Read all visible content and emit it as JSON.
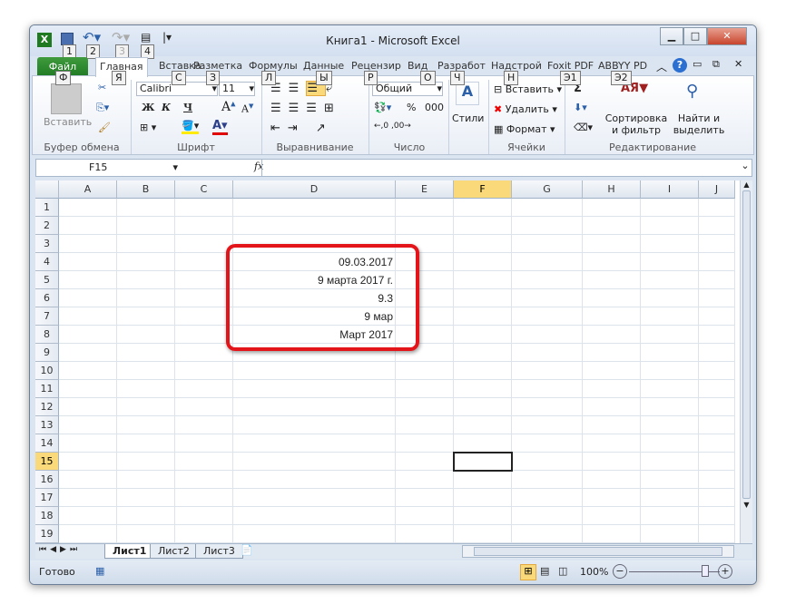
{
  "title": "Книга1  -  Microsoft Excel",
  "qat_keytips": [
    "1",
    "2",
    "3",
    "4"
  ],
  "file_tab": "Файл",
  "file_keytip": "Ф",
  "tabs": [
    {
      "label": "Главная",
      "keytip": "Я"
    },
    {
      "label": "Вставка",
      "keytip": "С"
    },
    {
      "label": "Разметка",
      "keytip": "З"
    },
    {
      "label": "Формулы",
      "keytip": "Л"
    },
    {
      "label": "Данные",
      "keytip": "Ы"
    },
    {
      "label": "Рецензир",
      "keytip": "Р"
    },
    {
      "label": "Вид",
      "keytip": "О"
    },
    {
      "label": "Разработ",
      "keytip": "Ч"
    },
    {
      "label": "Надстрой",
      "keytip": "Н"
    },
    {
      "label": "Foxit PDF",
      "keytip": "Э1"
    },
    {
      "label": "ABBYY PD",
      "keytip": "Э2"
    }
  ],
  "ribbon": {
    "paste": "Вставить",
    "clipboard": "Буфер обмена",
    "font_name": "Calibri",
    "font_size": "11",
    "bold": "Ж",
    "italic": "К",
    "underline": "Ч",
    "font": "Шрифт",
    "alignment": "Выравнивание",
    "number_format": "Общий",
    "percent": "%",
    "thousands": "000",
    "number": "Число",
    "styles": "Стили",
    "insert": "Вставить",
    "delete": "Удалить",
    "format": "Формат",
    "cells": "Ячейки",
    "sum": "Σ",
    "sort": "Сортировка",
    "sort2": "и фильтр",
    "find": "Найти и",
    "find2": "выделить",
    "editing": "Редактирование"
  },
  "name_box": "F15",
  "fx": "fx",
  "columns": [
    "A",
    "B",
    "C",
    "D",
    "E",
    "F",
    "G",
    "H",
    "I",
    "J"
  ],
  "rows": [
    "1",
    "2",
    "3",
    "4",
    "5",
    "6",
    "7",
    "8",
    "9",
    "10",
    "11",
    "12",
    "13",
    "14",
    "15",
    "16",
    "17",
    "18",
    "19"
  ],
  "selected_cell": "F15",
  "cells": [
    {
      "ref": "D4",
      "value": "09.03.2017"
    },
    {
      "ref": "D5",
      "value": "9 марта 2017 г."
    },
    {
      "ref": "D6",
      "value": "9.3"
    },
    {
      "ref": "D7",
      "value": "9 мар"
    },
    {
      "ref": "D8",
      "value": "Март 2017"
    }
  ],
  "highlight_color": "#e3151a",
  "sheets": [
    {
      "label": "Лист1",
      "active": true
    },
    {
      "label": "Лист2"
    },
    {
      "label": "Лист3"
    }
  ],
  "status": "Готово",
  "zoom": "100%",
  "zoom_level": 100
}
